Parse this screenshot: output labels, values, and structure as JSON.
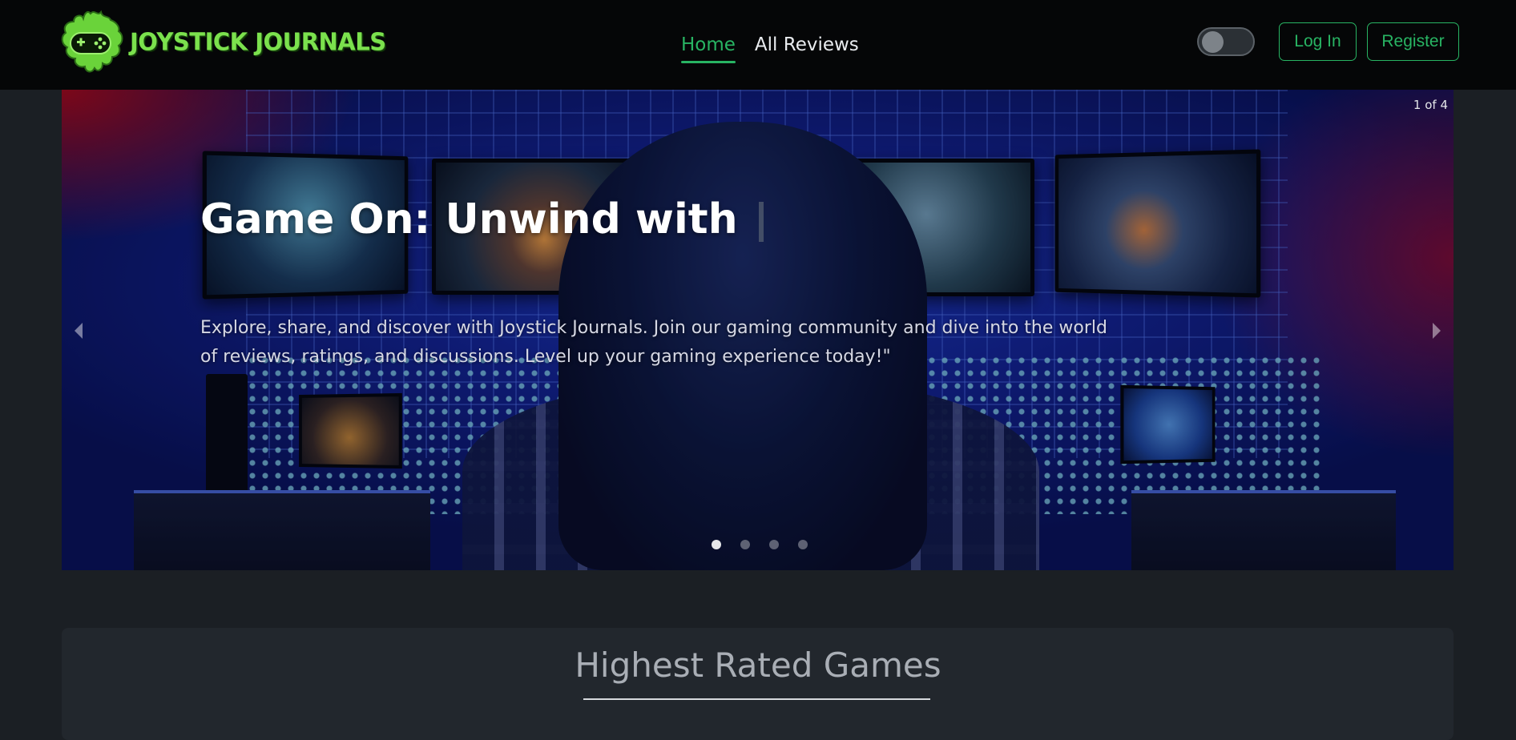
{
  "brand": {
    "name": "JOYSTICK JOURNALS",
    "logo_icon": "gamepad-splat-icon",
    "accent": "#7be14d"
  },
  "nav": {
    "links": [
      {
        "label": "Home",
        "active": true
      },
      {
        "label": "All Reviews",
        "active": false
      }
    ],
    "theme_toggle": {
      "state": "off",
      "icon": "toggle-switch-icon"
    },
    "login_label": "Log In",
    "register_label": "Register",
    "accent": "#28b463"
  },
  "carousel": {
    "counter": "1 of 4",
    "title": "Game On: Unwind with",
    "text": "Explore, share, and discover with Joystick Journals. Join our gaming community and dive into the world of reviews, ratings, and discussions. Level up your gaming experience today!\"",
    "prev_icon": "chevron-left-icon",
    "next_icon": "chevron-right-icon",
    "slides_total": 4,
    "active_slide": 1
  },
  "section": {
    "title": "Highest Rated Games"
  }
}
